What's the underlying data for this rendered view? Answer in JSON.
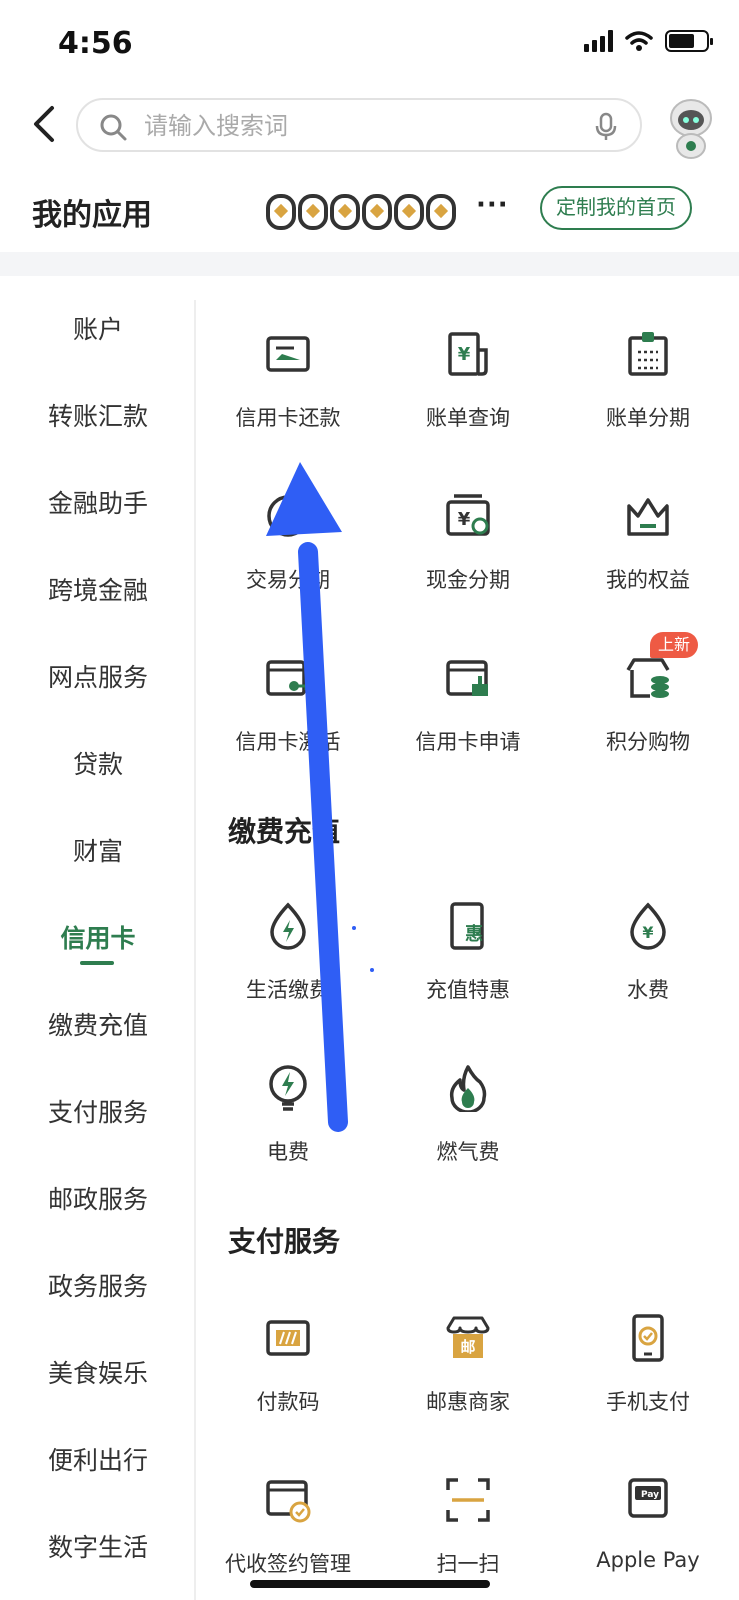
{
  "status_bar": {
    "time": "4:56"
  },
  "search": {
    "placeholder": "请输入搜索词"
  },
  "header": {
    "title": "我的应用",
    "more": "···",
    "customize_label": "定制我的首页"
  },
  "sidebar": {
    "items": [
      {
        "label": "账户"
      },
      {
        "label": "转账汇款"
      },
      {
        "label": "金融助手"
      },
      {
        "label": "跨境金融"
      },
      {
        "label": "网点服务"
      },
      {
        "label": "贷款"
      },
      {
        "label": "财富"
      },
      {
        "label": "信用卡",
        "active": true
      },
      {
        "label": "缴费充值"
      },
      {
        "label": "支付服务"
      },
      {
        "label": "邮政服务"
      },
      {
        "label": "政务服务"
      },
      {
        "label": "美食娱乐"
      },
      {
        "label": "便利出行"
      },
      {
        "label": "数字生活"
      }
    ]
  },
  "credit_card": {
    "items": [
      {
        "label": "信用卡还款",
        "icon": "card-repay-icon"
      },
      {
        "label": "账单查询",
        "icon": "bill-query-icon"
      },
      {
        "label": "账单分期",
        "icon": "bill-installment-icon"
      },
      {
        "label": "交易分期",
        "icon": "transaction-installment-icon"
      },
      {
        "label": "现金分期",
        "icon": "cash-installment-icon"
      },
      {
        "label": "我的权益",
        "icon": "crown-icon"
      },
      {
        "label": "信用卡激活",
        "icon": "card-activate-icon"
      },
      {
        "label": "信用卡申请",
        "icon": "card-apply-icon"
      },
      {
        "label": "积分购物",
        "icon": "points-shop-icon"
      }
    ],
    "new_badge": "上新"
  },
  "payment": {
    "title": "缴费充值",
    "items": [
      {
        "label": "生活缴费",
        "icon": "life-payment-icon"
      },
      {
        "label": "充值特惠",
        "icon": "topup-discount-icon"
      },
      {
        "label": "水费",
        "icon": "water-fee-icon"
      },
      {
        "label": "电费",
        "icon": "electric-fee-icon"
      },
      {
        "label": "燃气费",
        "icon": "gas-fee-icon"
      }
    ]
  },
  "pay_service": {
    "title": "支付服务",
    "items": [
      {
        "label": "付款码",
        "icon": "payment-code-icon"
      },
      {
        "label": "邮惠商家",
        "icon": "post-merchant-icon"
      },
      {
        "label": "手机支付",
        "icon": "mobile-pay-icon"
      },
      {
        "label": "代收签约管理",
        "icon": "collection-sign-icon"
      },
      {
        "label": "扫一扫",
        "icon": "scan-icon"
      },
      {
        "label": "Apple Pay",
        "icon": "apple-pay-icon"
      }
    ]
  },
  "colors": {
    "accent": "#2e7d4f",
    "icon_gold": "#d9a441",
    "arrow": "#2f5ef5",
    "badge": "#ee5a44"
  }
}
